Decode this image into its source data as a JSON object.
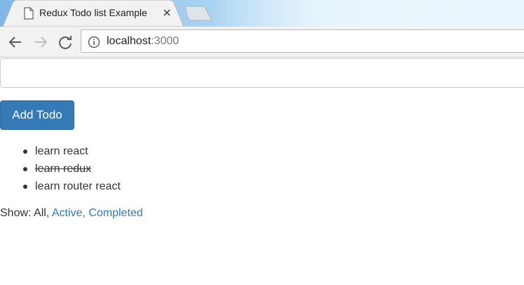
{
  "browser": {
    "tab_title": "Redux Todo list Example",
    "url_host": "localhost",
    "url_port": ":3000"
  },
  "form": {
    "input_value": "",
    "add_button_label": "Add Todo"
  },
  "todos": [
    {
      "text": "learn react",
      "completed": false
    },
    {
      "text": "learn redux",
      "completed": true
    },
    {
      "text": "learn router react",
      "completed": false
    }
  ],
  "filters": {
    "label": "Show:",
    "all": "All",
    "sep1": ",",
    "active": "Active",
    "sep2": ",",
    "completed": "Completed",
    "selected": "All"
  },
  "colors": {
    "primary": "#337ab7",
    "text": "#333333"
  }
}
